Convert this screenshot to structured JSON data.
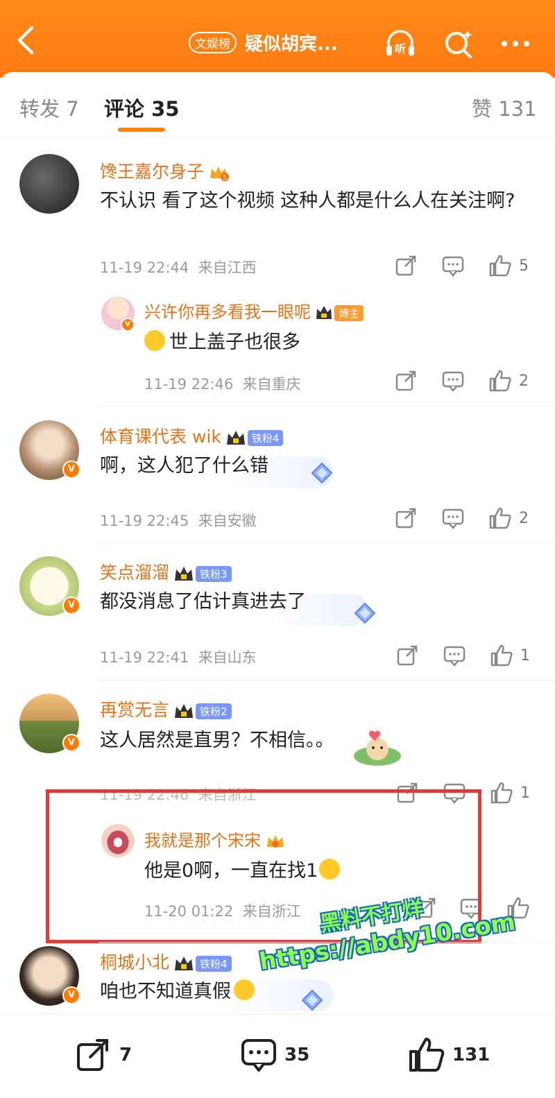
{
  "header": {
    "tag": "文娱榜",
    "title": "疑似胡宾...",
    "colors": {
      "bar": "#ff7f12",
      "accent": "#ff8200"
    }
  },
  "tabs": {
    "repost": "转发 7",
    "comments": "评论 35",
    "likes": "赞 131"
  },
  "comments": [
    {
      "username": "馋王嘉尔身子",
      "text": "不认识 看了这个视频 这种人都是什么人在关注啊?",
      "time": "11-19 22:44",
      "location": "来自江西",
      "likes": "5",
      "reply": {
        "username": "兴许你再多看我一眼呢",
        "badge": "博主",
        "text": "世上盖子也很多",
        "time": "11-19 22:46",
        "location": "来自重庆",
        "likes": "2"
      }
    },
    {
      "username": "体育课代表 wik",
      "badge": "铁粉4",
      "text": "啊，这人犯了什么错",
      "time": "11-19 22:45",
      "location": "来自安徽",
      "likes": "2"
    },
    {
      "username": "笑点溜溜",
      "badge": "铁粉3",
      "text": "都没消息了估计真进去了",
      "time": "11-19 22:41",
      "location": "来自山东",
      "likes": "1"
    },
    {
      "username": "再赏无言",
      "badge": "铁粉2",
      "text": "这人居然是直男？不相信。。",
      "time": "11-19 22:46",
      "location": "来自浙江",
      "likes": "1",
      "reply": {
        "username": "我就是那个宋宋",
        "text": "他是0啊，一直在找1",
        "time": "11-20 01:22",
        "location": "来自浙江",
        "likes": ""
      }
    },
    {
      "username": "桐城小北",
      "badge": "铁粉4",
      "text": "咱也不知道真假"
    }
  ],
  "watermark": {
    "line1": "黑料不打烊",
    "line2": "https://abdy10.com"
  },
  "bottom": {
    "repost_count": "7",
    "comment_count": "35",
    "like_count": "131"
  }
}
